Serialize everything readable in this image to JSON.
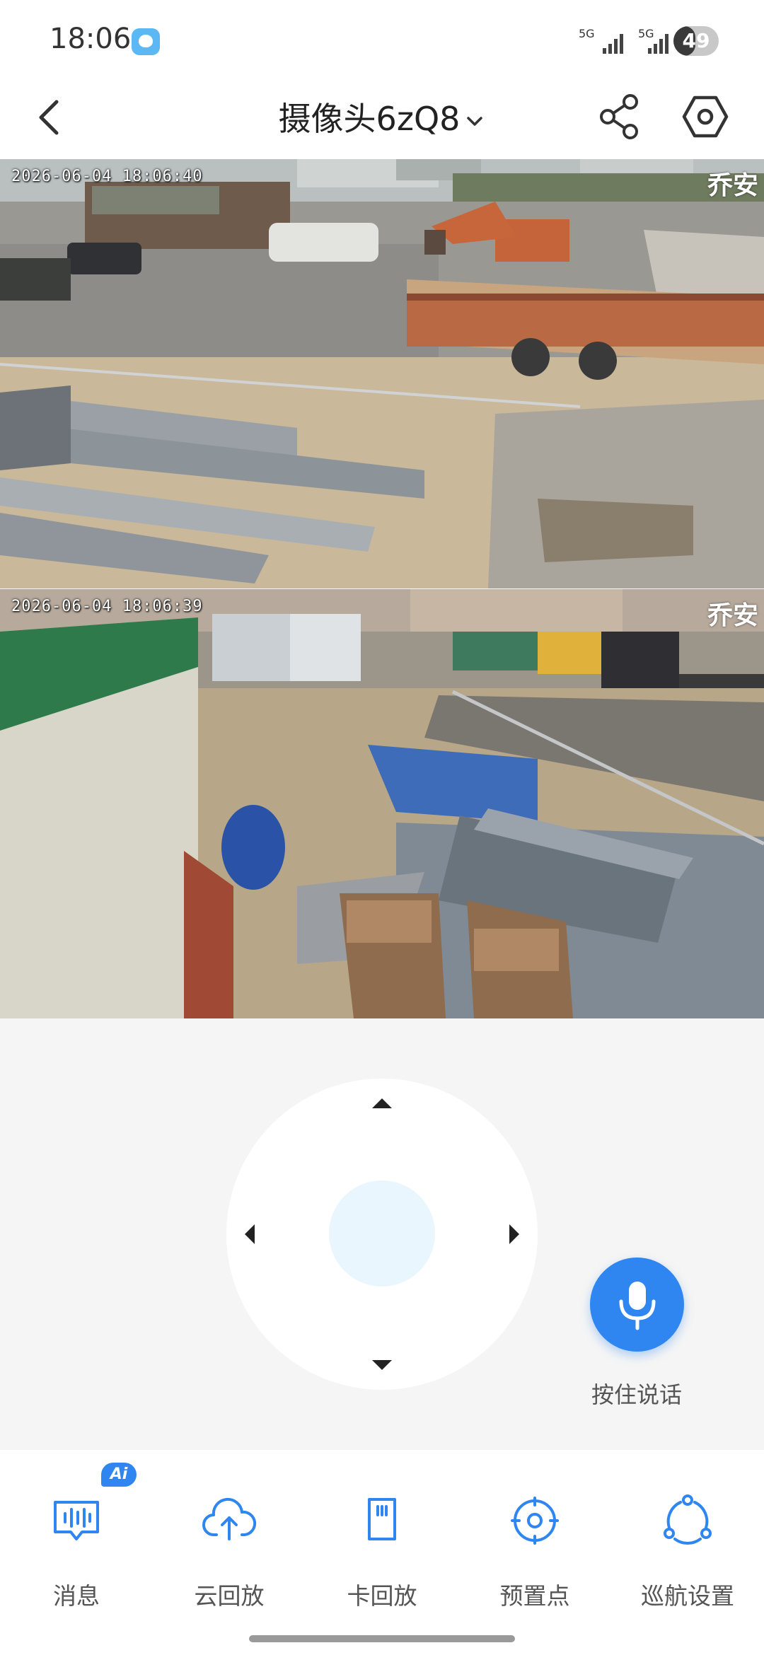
{
  "status_bar": {
    "time": "18:06",
    "signal_1_tag": "5G",
    "signal_2_tag": "5G",
    "battery_level": "49",
    "battery_fraction": 0.49
  },
  "nav": {
    "title": "摄像头6zQ8",
    "back_icon": "back-arrow-icon",
    "share_icon": "share-icon",
    "settings_icon": "hexagon-settings-icon"
  },
  "feeds": [
    {
      "timestamp": "2026-06-04 18:06:40",
      "watermark": "乔安"
    },
    {
      "timestamp": "2026-06-04 18:06:39",
      "watermark": "乔安"
    }
  ],
  "ptz": {
    "up_icon": "triangle-up-icon",
    "down_icon": "triangle-down-icon",
    "left_icon": "triangle-left-icon",
    "right_icon": "triangle-right-icon"
  },
  "talk": {
    "label": "按住说话",
    "icon": "microphone-icon"
  },
  "toolbar": {
    "ai_badge": "Ai",
    "items": [
      {
        "label": "消息",
        "icon": "message-waveform-icon"
      },
      {
        "label": "云回放",
        "icon": "cloud-upload-icon"
      },
      {
        "label": "卡回放",
        "icon": "sd-card-icon"
      },
      {
        "label": "预置点",
        "icon": "preset-target-icon"
      },
      {
        "label": "巡航设置",
        "icon": "cruise-nodes-icon"
      }
    ]
  },
  "colors": {
    "accent": "#2f86f0",
    "background": "#f5f5f5",
    "surface": "#ffffff"
  }
}
